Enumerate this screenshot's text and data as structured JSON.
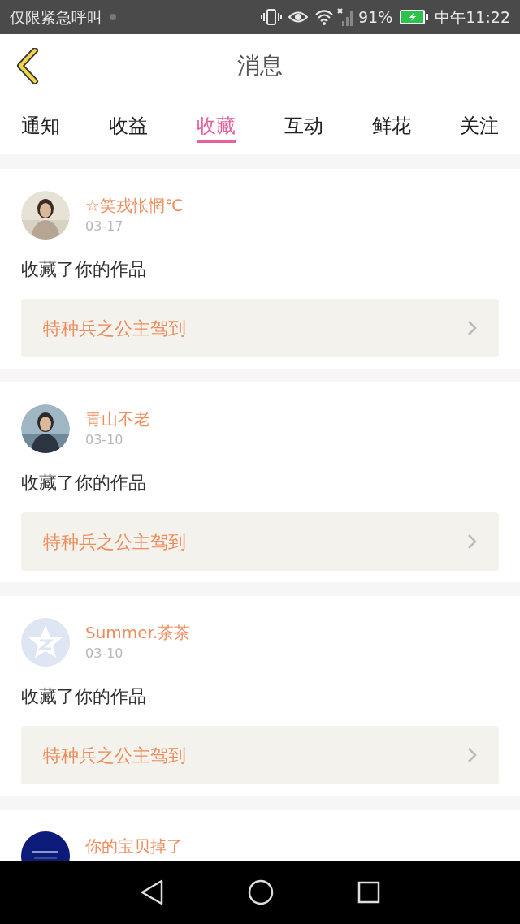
{
  "status_bar": {
    "carrier": "仅限紧急呼叫",
    "battery": "91%",
    "time": "中午11:22"
  },
  "header": {
    "title": "消息"
  },
  "tabs": [
    {
      "label": "通知",
      "selected": false
    },
    {
      "label": "收益",
      "selected": false
    },
    {
      "label": "收藏",
      "selected": true
    },
    {
      "label": "互动",
      "selected": false
    },
    {
      "label": "鲜花",
      "selected": false
    },
    {
      "label": "关注",
      "selected": false
    }
  ],
  "messages": [
    {
      "name": "☆笑戎怅惘℃",
      "date": "03-17",
      "text": "收藏了你的作品",
      "work": "特种兵之公主驾到"
    },
    {
      "name": "青山不老",
      "date": "03-10",
      "text": "收藏了你的作品",
      "work": "特种兵之公主驾到"
    },
    {
      "kind": "default",
      "name": "Summer.茶茶",
      "date": "03-10",
      "text": "收藏了你的作品",
      "work": "特种兵之公主驾到"
    },
    {
      "kind": "dark",
      "name": "你的宝贝掉了"
    }
  ]
}
